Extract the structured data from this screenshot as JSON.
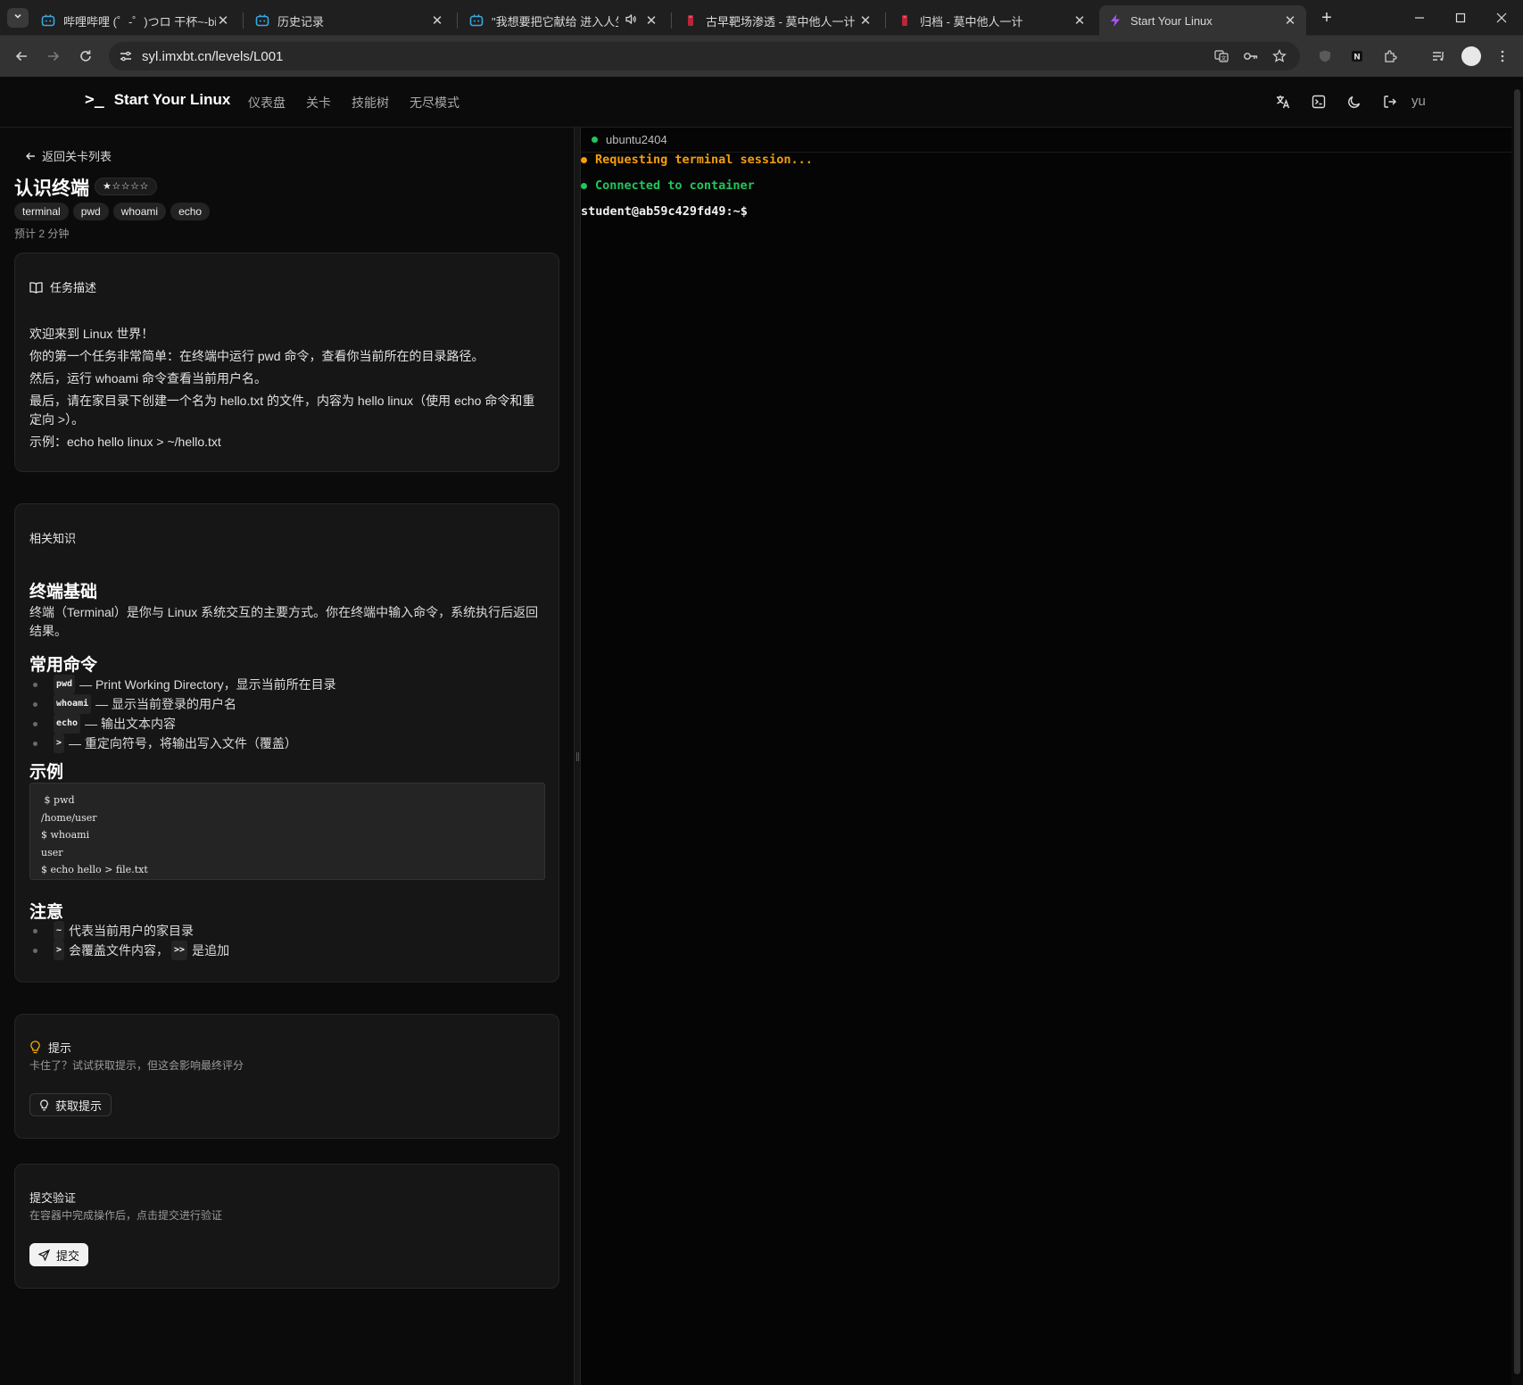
{
  "browser": {
    "tabs": [
      {
        "title": "哔哩哔哩 (゜-゜)つロ 干杯~-bili",
        "icon": "bilibili-icon"
      },
      {
        "title": "历史记录",
        "icon": "bilibili-icon"
      },
      {
        "title": "\"我想要把它献给 进入人生新",
        "icon": "bilibili-icon"
      },
      {
        "title": "古早靶场渗透 - 莫中他人一计",
        "icon": "book-icon"
      },
      {
        "title": "归档 - 莫中他人一计",
        "icon": "book-icon"
      },
      {
        "title": "Start Your Linux",
        "icon": "bolt-icon"
      }
    ],
    "url": "syl.imxbt.cn/levels/L001"
  },
  "app": {
    "brand": "Start Your Linux",
    "brand_icon": ">_",
    "nav": [
      "仪表盘",
      "关卡",
      "技能树",
      "无尽模式"
    ],
    "user": "yu"
  },
  "level": {
    "back_label": "返回关卡列表",
    "title": "认识终端",
    "stars": "★☆☆☆☆",
    "tags": [
      "terminal",
      "pwd",
      "whoami",
      "echo"
    ],
    "estimate": "预计 2 分钟"
  },
  "task": {
    "heading": "任务描述",
    "lines": [
      "欢迎来到 Linux 世界！",
      "你的第一个任务非常简单：在终端中运行 pwd 命令，查看你当前所在的目录路径。",
      "然后，运行 whoami 命令查看当前用户名。",
      "最后，请在家目录下创建一个名为 hello.txt 的文件，内容为 hello linux（使用 echo 命令和重定向 >）。",
      "示例：echo hello linux > ~/hello.txt"
    ]
  },
  "knowledge": {
    "heading": "相关知识",
    "section1_title": "终端基础",
    "section1_text": "终端（Terminal）是你与 Linux 系统交互的主要方式。你在终端中输入命令，系统执行后返回结果。",
    "section2_title": "常用命令",
    "commands": [
      {
        "code": "pwd",
        "text": "— Print Working Directory，显示当前所在目录"
      },
      {
        "code": "whoami",
        "text": "— 显示当前登录的用户名"
      },
      {
        "code": "echo",
        "text": "— 输出文本内容"
      },
      {
        "code": ">",
        "text": "— 重定向符号，将输出写入文件（覆盖）"
      }
    ],
    "section3_title": "示例",
    "example_lines": [
      " $ pwd",
      "/home/user",
      "$ whoami",
      "user",
      "$ echo hello > file.txt"
    ],
    "section4_title": "注意",
    "notes": [
      {
        "code": "~",
        "text": "代表当前用户的家目录"
      },
      {
        "code": ">",
        "text": "会覆盖文件内容，",
        "code2": ">>",
        "text2": "是追加"
      }
    ]
  },
  "hint": {
    "heading": "提示",
    "subtitle": "卡住了？试试获取提示，但这会影响最终评分",
    "button": "获取提示"
  },
  "submit": {
    "heading": "提交验证",
    "subtitle": "在容器中完成操作后，点击提交进行验证",
    "button": "提交"
  },
  "terminal": {
    "container": "ubuntu2404",
    "lines": [
      {
        "text": "Requesting terminal session...",
        "color": "#f59e0b"
      },
      {
        "text": "Connected to container",
        "color": "#22c55e"
      }
    ],
    "prompt": "student@ab59c429fd49:~$"
  }
}
